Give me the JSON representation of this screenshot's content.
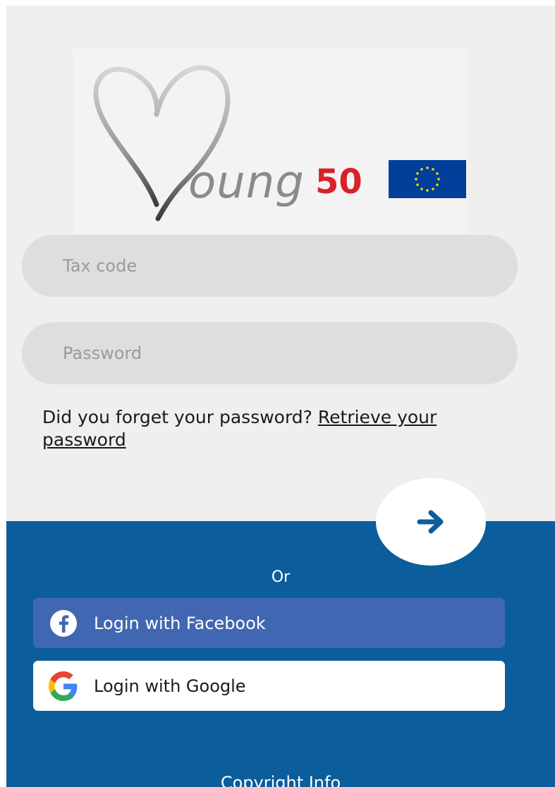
{
  "logo": {
    "wordmark": "oung",
    "number": "50",
    "flag": "eu-flag-icon"
  },
  "form": {
    "tax_code_placeholder": "Tax code",
    "password_placeholder": "Password",
    "forgot_text": "Did you forget your password? ",
    "retrieve_link": "Retrieve your password",
    "submit_icon": "arrow-right-icon"
  },
  "social": {
    "or_label": "Or",
    "facebook_label": "Login with Facebook",
    "google_label": "Login with Google",
    "facebook_icon": "facebook-icon",
    "google_icon": "google-icon"
  },
  "footer": {
    "copyright_label": "Copyright Info"
  },
  "colors": {
    "primary_blue": "#0b5d9b",
    "facebook_blue": "#4267b2",
    "logo_red": "#d9212a",
    "eu_blue": "#003f9a",
    "eu_gold": "#ffd700"
  }
}
